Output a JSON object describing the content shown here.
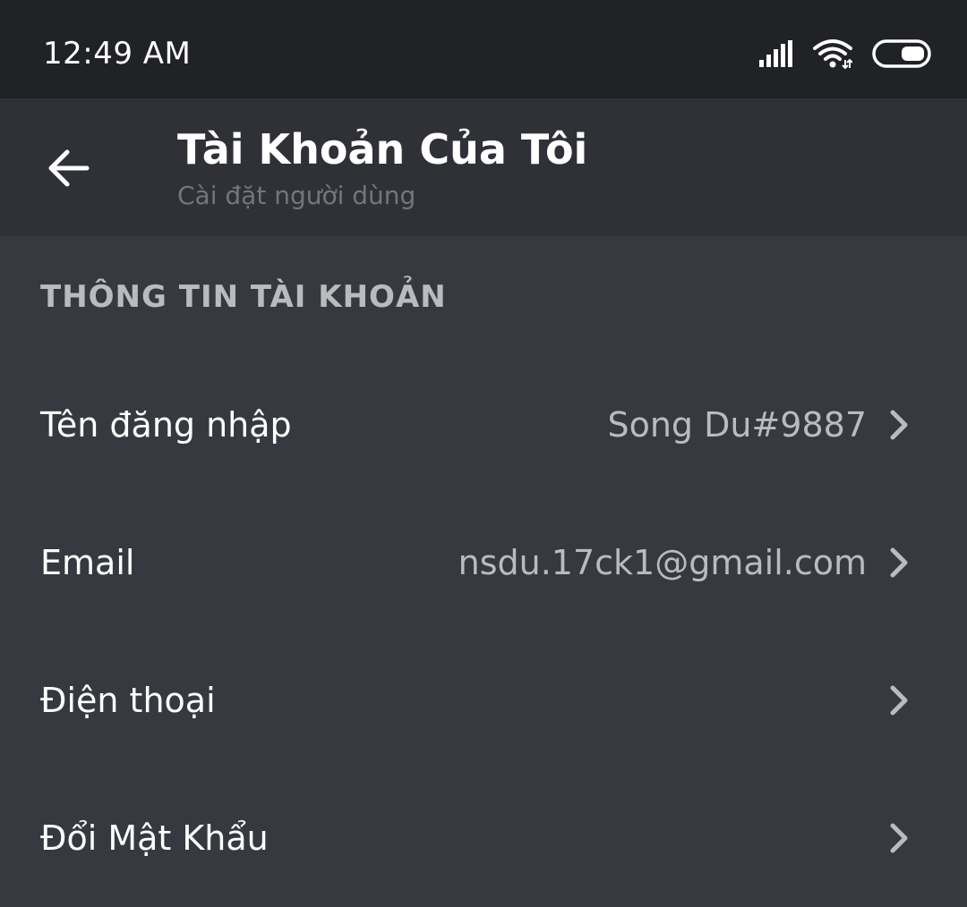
{
  "status_bar": {
    "time": "12:49  AM",
    "icons": [
      "signal-icon",
      "wifi-icon",
      "battery-icon"
    ]
  },
  "header": {
    "title": "Tài Khoản Của Tôi",
    "subtitle": "Cài đặt người dùng",
    "back_icon": "arrow-left-icon"
  },
  "section": {
    "title": "THÔNG TIN TÀI KHOẢN"
  },
  "rows": [
    {
      "label": "Tên đăng nhập",
      "value": "Song Du#9887"
    },
    {
      "label": "Email",
      "value": "nsdu.17ck1@gmail.com"
    },
    {
      "label": "Điện thoại",
      "value": ""
    },
    {
      "label": "Đổi Mật Khẩu",
      "value": ""
    }
  ],
  "colors": {
    "background": "#36393f",
    "header_bg": "#2f3136",
    "status_bar_bg": "#202225",
    "text_primary": "#ffffff",
    "text_secondary": "#b9bbbe",
    "text_muted": "#72767d"
  }
}
